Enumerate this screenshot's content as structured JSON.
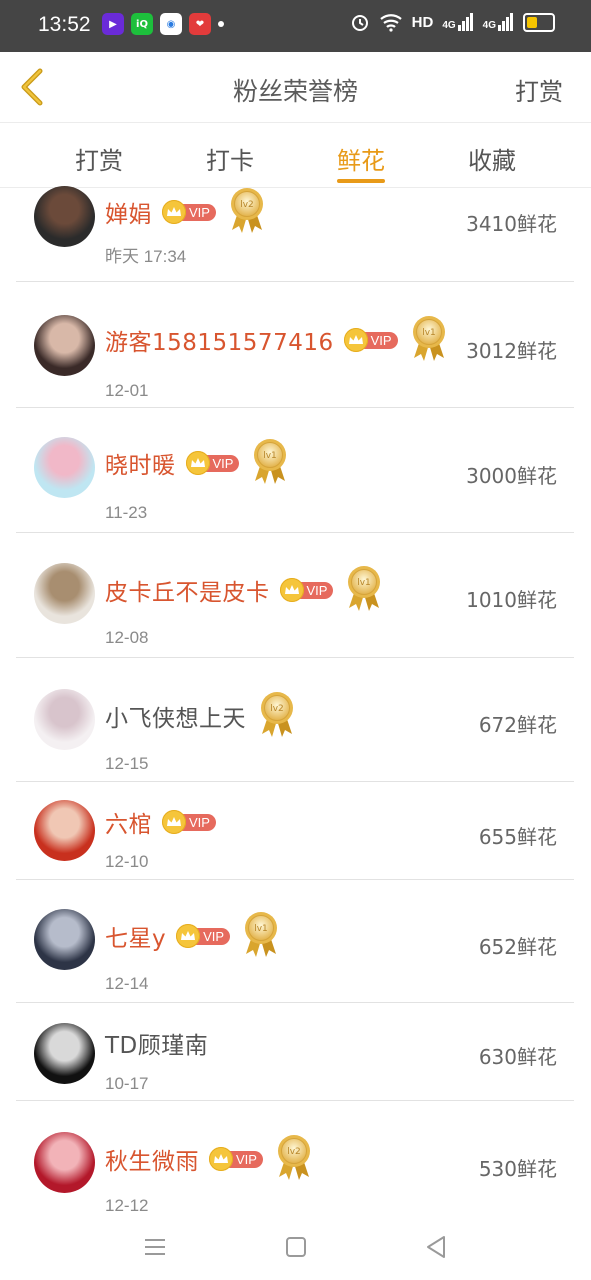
{
  "status_bar": {
    "time": "13:52",
    "apps": [
      {
        "icon": "video-app-icon",
        "color": "#6a2bd8",
        "glyph": "▶"
      },
      {
        "icon": "iqiyi-app-icon",
        "color": "#1dbf3c",
        "glyph": "iQ"
      },
      {
        "icon": "browser-app-icon",
        "color": "#ffffff",
        "glyph": "◉"
      },
      {
        "icon": "heart-app-icon",
        "color": "#e23b3b",
        "glyph": "❤"
      }
    ],
    "hd_label": "HD",
    "net1": "4G",
    "net2": "4G",
    "battery_level": 0.45
  },
  "header": {
    "title": "粉丝荣誉榜",
    "right_action": "打赏"
  },
  "tabs": [
    {
      "label": "打赏",
      "active": false
    },
    {
      "label": "打卡",
      "active": false
    },
    {
      "label": "鲜花",
      "active": true
    },
    {
      "label": "收藏",
      "active": false
    }
  ],
  "fans": [
    {
      "name": "婵娟",
      "vip": true,
      "vip_label": "VIP",
      "level": "lv2",
      "date": "昨天 17:34",
      "flowers": "3410鲜花",
      "avatar_colors": [
        "#2b2b2b",
        "#6b4a3a"
      ]
    },
    {
      "name": "游客158151577416",
      "vip": true,
      "vip_label": "VIP",
      "level": "lv1",
      "date": "12-01",
      "flowers": "3012鲜花",
      "avatar_colors": [
        "#3a2a28",
        "#d8b8a8"
      ]
    },
    {
      "name": "晓时暖",
      "vip": true,
      "vip_label": "VIP",
      "level": "lv1",
      "date": "11-23",
      "flowers": "3000鲜花",
      "avatar_colors": [
        "#bfe6f2",
        "#f1b8c8"
      ]
    },
    {
      "name": "皮卡丘不是皮卡",
      "vip": true,
      "vip_label": "VIP",
      "level": "lv1",
      "date": "12-08",
      "flowers": "1010鲜花",
      "avatar_colors": [
        "#e9e4dd",
        "#a88e70"
      ]
    },
    {
      "name": "小飞侠想上天",
      "vip": false,
      "vip_label": "",
      "level": "lv2",
      "date": "12-15",
      "flowers": "672鲜花",
      "avatar_colors": [
        "#f4f0f2",
        "#d8c4cc"
      ]
    },
    {
      "name": "六棺",
      "vip": true,
      "vip_label": "VIP",
      "level": "",
      "date": "12-10",
      "flowers": "655鲜花",
      "avatar_colors": [
        "#c8301e",
        "#f0c7b4"
      ]
    },
    {
      "name": "七星y",
      "vip": true,
      "vip_label": "VIP",
      "level": "lv1",
      "date": "12-14",
      "flowers": "652鲜花",
      "avatar_colors": [
        "#2d3446",
        "#b6bccb"
      ]
    },
    {
      "name": "TD顾瑾南",
      "vip": false,
      "vip_label": "",
      "level": "",
      "date": "10-17",
      "flowers": "630鲜花",
      "avatar_colors": [
        "#111111",
        "#d9d9d9"
      ]
    },
    {
      "name": "秋生微雨",
      "vip": true,
      "vip_label": "VIP",
      "level": "lv2",
      "date": "12-12",
      "flowers": "530鲜花",
      "avatar_colors": [
        "#b3182a",
        "#f2b3b8"
      ]
    }
  ],
  "nav": {
    "menu_icon": "menu-icon",
    "home_icon": "home-square-icon",
    "back_icon": "back-triangle-icon"
  },
  "colors": {
    "accent": "#e89a18",
    "vip_name": "#d8552f",
    "vip_tag": "#e66a5d",
    "statusbar": "#454545"
  }
}
